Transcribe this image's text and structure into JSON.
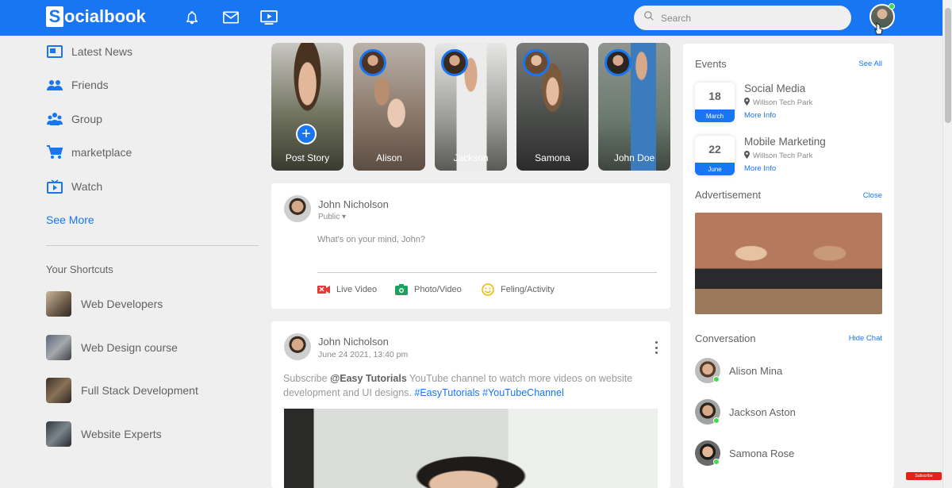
{
  "navbar": {
    "logo_initial": "S",
    "logo_rest": "ocialbook",
    "search_placeholder": "Search"
  },
  "sidebar": {
    "items": [
      {
        "label": "Latest News",
        "icon": "news-icon"
      },
      {
        "label": "Friends",
        "icon": "friends-icon"
      },
      {
        "label": "Group",
        "icon": "group-icon"
      },
      {
        "label": "marketplace",
        "icon": "cart-icon"
      },
      {
        "label": "Watch",
        "icon": "tv-icon"
      }
    ],
    "see_more": "See More",
    "shortcuts_title": "Your Shortcuts",
    "shortcuts": [
      {
        "label": "Web Developers"
      },
      {
        "label": "Web Design course"
      },
      {
        "label": "Full Stack Development"
      },
      {
        "label": "Website Experts"
      }
    ]
  },
  "stories": [
    {
      "name": "Post Story"
    },
    {
      "name": "Alison"
    },
    {
      "name": "Jackson"
    },
    {
      "name": "Samona"
    },
    {
      "name": "John Doe"
    }
  ],
  "write_post": {
    "user_name": "John Nicholson",
    "privacy": "Public",
    "placeholder": "What's on your mind, John?",
    "actions": [
      {
        "label": "Live Video",
        "icon": "live-video-icon"
      },
      {
        "label": "Photo/Video",
        "icon": "photo-icon"
      },
      {
        "label": "Feling/Activity",
        "icon": "smiley-icon"
      }
    ]
  },
  "post": {
    "user_name": "John Nicholson",
    "timestamp": "June 24 2021, 13:40 pm",
    "text_before": "Subscribe ",
    "text_bold": "@Easy Tutorials",
    "text_after": " YouTube channel to watch more videos on website development and UI designs. ",
    "tag1": "#EasyTutorials",
    "tag2": "#YouTubeChannel"
  },
  "right": {
    "events_title": "Events",
    "events_link": "See All",
    "events": [
      {
        "day": "18",
        "month": "March",
        "title": "Social Media",
        "location": "Willson Tech Park",
        "more": "More Info"
      },
      {
        "day": "22",
        "month": "June",
        "title": "Mobile Marketing",
        "location": "Willson Tech Park",
        "more": "More Info"
      }
    ],
    "ad_title": "Advertisement",
    "ad_link": "Close",
    "conv_title": "Conversation",
    "conv_link": "Hide Chat",
    "chats": [
      {
        "name": "Alison Mina"
      },
      {
        "name": "Jackson Aston"
      },
      {
        "name": "Samona Rose"
      }
    ]
  },
  "badge": "Subscribe",
  "colors": {
    "brand": "#1876f2",
    "online": "#41db51",
    "background": "#efefef"
  }
}
